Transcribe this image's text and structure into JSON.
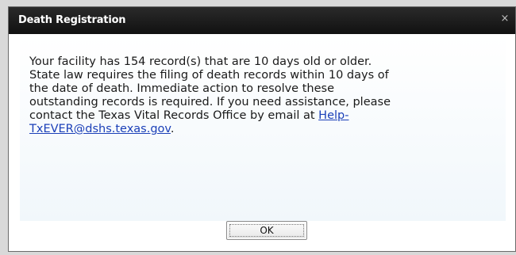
{
  "dialog": {
    "title": "Death Registration",
    "close_label": "×",
    "message_text": "Your facility has 154 record(s) that are 10 days old or older.\nState law requires the filing of death records within 10 days of\nthe date of death. Immediate action to resolve these\noutstanding records is required. If you need assistance, please\ncontact the Texas Vital Records Office by email at ",
    "email_link_line1": "Help-",
    "email_link_line2": "TxEVER@dshs.texas.gov",
    "message_tail": ".",
    "ok_label": "OK"
  },
  "colors": {
    "titlebar": "#1a1a1a",
    "link": "#1a3fb8"
  },
  "icons": {
    "close": "close-icon"
  }
}
